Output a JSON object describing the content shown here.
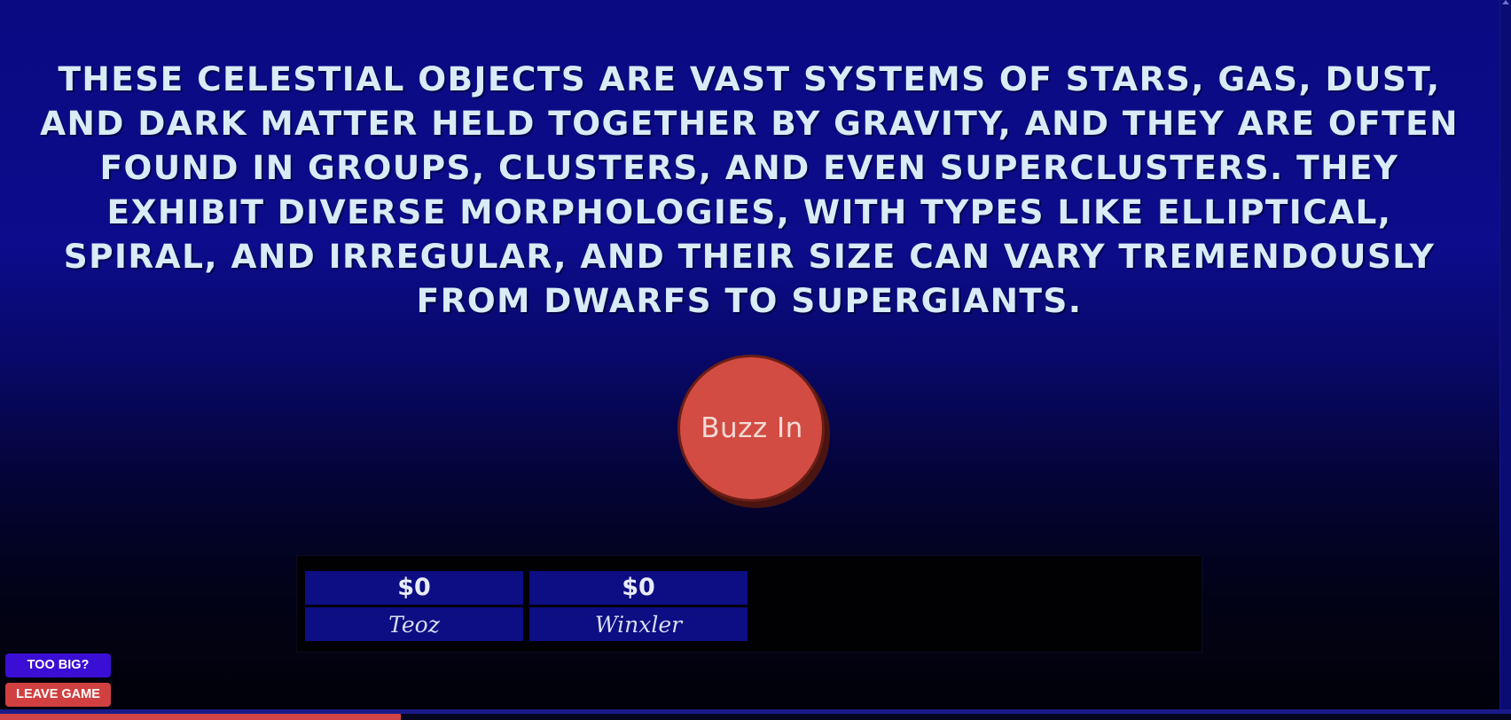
{
  "clue": {
    "text": "These celestial objects are vast systems of stars, gas, dust, and dark matter held together by gravity, and they are often found in groups, clusters, and even superclusters. They exhibit diverse morphologies, with types like elliptical, spiral, and irregular, and their size can vary tremendously from dwarfs to supergiants."
  },
  "buzzer": {
    "label": "Buzz In"
  },
  "players": [
    {
      "score": "$0",
      "name": "Teoz"
    },
    {
      "score": "$0",
      "name": "Winxler"
    }
  ],
  "controls": {
    "too_big_label": "TOO BIG?",
    "leave_game_label": "LEAVE GAME"
  },
  "timer": {
    "remaining_fraction": 0.265
  },
  "colors": {
    "background_top": "#0a0a82",
    "background_bottom": "#010108",
    "clue_text": "#d8ebf6",
    "buzzer": "#d24c43",
    "player_panel": "#0d0d84",
    "too_big_button": "#3a0ed4",
    "leave_game_button": "#d04040",
    "timer_fill": "#cf4444"
  }
}
